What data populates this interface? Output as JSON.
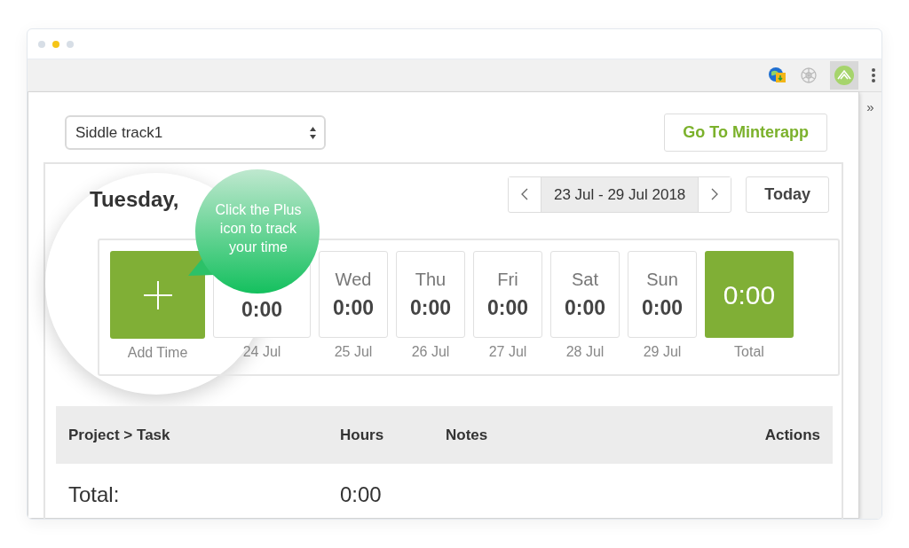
{
  "window": {
    "dots": [
      {
        "color": "#d7dee6"
      },
      {
        "color": "#f5c518"
      },
      {
        "color": "#d7dee6"
      }
    ],
    "overflow": "»"
  },
  "popup": {
    "project_select": {
      "value": "Siddle track1"
    },
    "open_button": "Go To Minterapp",
    "heading": "Tuesday,",
    "date_range": "23 Jul - 29 Jul 2018",
    "today_button": "Today",
    "tooltip": "Click the Plus icon to track your time",
    "days": [
      {
        "kind": "add",
        "label": "Add Time"
      },
      {
        "kind": "day",
        "value": "0:00",
        "date": "24 Jul"
      },
      {
        "kind": "day",
        "day": "Wed",
        "value": "0:00",
        "date": "25 Jul"
      },
      {
        "kind": "day",
        "day": "Thu",
        "value": "0:00",
        "date": "26 Jul"
      },
      {
        "kind": "day",
        "day": "Fri",
        "value": "0:00",
        "date": "27 Jul"
      },
      {
        "kind": "day",
        "day": "Sat",
        "value": "0:00",
        "date": "28 Jul"
      },
      {
        "kind": "day",
        "day": "Sun",
        "value": "0:00",
        "date": "29 Jul"
      },
      {
        "kind": "total",
        "value": "0:00",
        "label": "Total"
      }
    ],
    "table": {
      "columns": [
        "Project > Task",
        "Hours",
        "Notes",
        "Actions"
      ],
      "rows": [
        [
          "Total:",
          "0:00"
        ]
      ]
    }
  }
}
